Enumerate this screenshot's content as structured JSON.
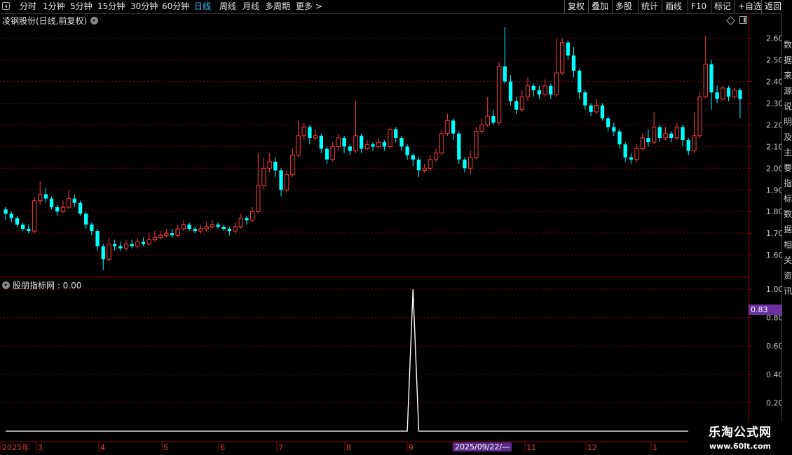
{
  "toolbar": {
    "periods": [
      "分时",
      "1分钟",
      "5分钟",
      "15分钟",
      "30分钟",
      "60分钟",
      "日线",
      "周线",
      "月线",
      "多周期",
      "更多 >"
    ],
    "active_period": "日线",
    "right_buttons": [
      "复权",
      "叠加",
      "多股",
      "统计",
      "画线",
      "F10",
      "标记",
      "+自选",
      "返回"
    ]
  },
  "main_title": "凌钢股份(日线,前复权)",
  "indicator_label": "股朋指标网 : 0.00",
  "value_tag": "0.83",
  "date_tag": "2025/09/22/—",
  "watermark": {
    "line1": "乐淘公式网",
    "line2": "www.60lt.com"
  },
  "right_strip_chars": [
    "数",
    "据",
    "来",
    "源",
    "说",
    "明",
    "及",
    "主",
    "要",
    "指",
    "标",
    "数",
    "据",
    "相",
    "关",
    "资",
    "讯"
  ],
  "x_axis_labels": [
    "2025年",
    "3",
    "4",
    "5",
    "6",
    "7",
    "8",
    "9",
    "10",
    "11",
    "12",
    "1"
  ],
  "colors": {
    "up": "#ff3c3c",
    "down": "#00ffff",
    "grid": "#7a0000",
    "axis": "#8b0000"
  },
  "chart_data": [
    {
      "type": "candlestick",
      "title": "凌钢股份(日线,前复权)",
      "y_ticks": [
        "2.60",
        "2.50",
        "2.40",
        "2.30",
        "2.20",
        "2.10",
        "2.00",
        "1.90",
        "1.80",
        "1.70",
        "1.60"
      ],
      "ylim": [
        1.51,
        2.66
      ],
      "candles": [
        [
          1.81,
          1.79,
          1.82,
          1.76
        ],
        [
          1.79,
          1.77,
          1.8,
          1.75
        ],
        [
          1.77,
          1.74,
          1.78,
          1.73
        ],
        [
          1.74,
          1.72,
          1.75,
          1.71
        ],
        [
          1.72,
          1.71,
          1.74,
          1.7
        ],
        [
          1.71,
          1.85,
          1.87,
          1.7
        ],
        [
          1.85,
          1.88,
          1.94,
          1.83
        ],
        [
          1.88,
          1.86,
          1.91,
          1.84
        ],
        [
          1.86,
          1.82,
          1.87,
          1.81
        ],
        [
          1.82,
          1.8,
          1.83,
          1.78
        ],
        [
          1.8,
          1.82,
          1.85,
          1.79
        ],
        [
          1.82,
          1.86,
          1.9,
          1.81
        ],
        [
          1.86,
          1.84,
          1.88,
          1.82
        ],
        [
          1.84,
          1.79,
          1.85,
          1.78
        ],
        [
          1.79,
          1.74,
          1.8,
          1.72
        ],
        [
          1.74,
          1.71,
          1.75,
          1.69
        ],
        [
          1.71,
          1.64,
          1.72,
          1.62
        ],
        [
          1.64,
          1.58,
          1.65,
          1.53
        ],
        [
          1.58,
          1.65,
          1.68,
          1.57
        ],
        [
          1.65,
          1.64,
          1.67,
          1.62
        ],
        [
          1.64,
          1.63,
          1.66,
          1.62
        ],
        [
          1.63,
          1.65,
          1.67,
          1.62
        ],
        [
          1.65,
          1.64,
          1.67,
          1.63
        ],
        [
          1.64,
          1.66,
          1.68,
          1.63
        ],
        [
          1.66,
          1.65,
          1.68,
          1.64
        ],
        [
          1.65,
          1.67,
          1.7,
          1.64
        ],
        [
          1.67,
          1.68,
          1.71,
          1.66
        ],
        [
          1.68,
          1.69,
          1.71,
          1.67
        ],
        [
          1.69,
          1.7,
          1.72,
          1.68
        ],
        [
          1.7,
          1.69,
          1.72,
          1.68
        ],
        [
          1.69,
          1.72,
          1.74,
          1.68
        ],
        [
          1.72,
          1.74,
          1.76,
          1.71
        ],
        [
          1.74,
          1.72,
          1.75,
          1.71
        ],
        [
          1.72,
          1.71,
          1.73,
          1.7
        ],
        [
          1.71,
          1.72,
          1.74,
          1.7
        ],
        [
          1.72,
          1.73,
          1.75,
          1.71
        ],
        [
          1.73,
          1.74,
          1.76,
          1.72
        ],
        [
          1.74,
          1.73,
          1.75,
          1.72
        ],
        [
          1.73,
          1.72,
          1.74,
          1.71
        ],
        [
          1.72,
          1.71,
          1.73,
          1.69
        ],
        [
          1.71,
          1.73,
          1.75,
          1.7
        ],
        [
          1.73,
          1.77,
          1.79,
          1.72
        ],
        [
          1.77,
          1.76,
          1.78,
          1.74
        ],
        [
          1.76,
          1.8,
          1.82,
          1.75
        ],
        [
          1.8,
          1.92,
          2.07,
          1.79
        ],
        [
          1.92,
          2.0,
          2.05,
          1.9
        ],
        [
          2.0,
          2.03,
          2.07,
          1.98
        ],
        [
          2.03,
          1.99,
          2.05,
          1.96
        ],
        [
          1.99,
          1.9,
          2.0,
          1.87
        ],
        [
          1.9,
          1.97,
          1.99,
          1.89
        ],
        [
          1.97,
          2.06,
          2.09,
          1.96
        ],
        [
          2.06,
          2.15,
          2.22,
          2.05
        ],
        [
          2.15,
          2.19,
          2.21,
          2.13
        ],
        [
          2.19,
          2.14,
          2.2,
          2.11
        ],
        [
          2.14,
          2.15,
          2.18,
          2.13
        ],
        [
          2.15,
          2.09,
          2.16,
          2.07
        ],
        [
          2.09,
          2.04,
          2.1,
          2.02
        ],
        [
          2.04,
          2.1,
          2.12,
          2.03
        ],
        [
          2.1,
          2.14,
          2.16,
          2.08
        ],
        [
          2.14,
          2.1,
          2.15,
          2.07
        ],
        [
          2.1,
          2.08,
          2.11,
          2.06
        ],
        [
          2.08,
          2.15,
          2.31,
          2.07
        ],
        [
          2.15,
          2.09,
          2.16,
          2.07
        ],
        [
          2.09,
          2.11,
          2.13,
          2.08
        ],
        [
          2.11,
          2.1,
          2.12,
          2.08
        ],
        [
          2.1,
          2.12,
          2.14,
          2.09
        ],
        [
          2.12,
          2.1,
          2.13,
          2.08
        ],
        [
          2.1,
          2.18,
          2.19,
          2.09
        ],
        [
          2.18,
          2.14,
          2.19,
          2.12
        ],
        [
          2.14,
          2.1,
          2.15,
          2.08
        ],
        [
          2.1,
          2.06,
          2.11,
          2.04
        ],
        [
          2.06,
          2.04,
          2.07,
          2.01
        ],
        [
          2.04,
          1.99,
          2.05,
          1.96
        ],
        [
          1.99,
          2.0,
          2.02,
          1.98
        ],
        [
          2.0,
          2.04,
          2.06,
          1.99
        ],
        [
          2.04,
          2.07,
          2.09,
          2.03
        ],
        [
          2.07,
          2.16,
          2.18,
          2.06
        ],
        [
          2.16,
          2.22,
          2.25,
          2.15
        ],
        [
          2.22,
          2.16,
          2.23,
          2.13
        ],
        [
          2.16,
          2.04,
          2.17,
          2.02
        ],
        [
          2.04,
          2.0,
          2.05,
          1.98
        ],
        [
          2.0,
          2.05,
          2.08,
          1.97
        ],
        [
          2.05,
          2.17,
          2.19,
          2.04
        ],
        [
          2.17,
          2.2,
          2.23,
          2.16
        ],
        [
          2.2,
          2.24,
          2.33,
          2.19
        ],
        [
          2.24,
          2.21,
          2.27,
          2.2
        ],
        [
          2.21,
          2.47,
          2.49,
          2.2
        ],
        [
          2.47,
          2.4,
          2.65,
          2.39
        ],
        [
          2.4,
          2.31,
          2.43,
          2.29
        ],
        [
          2.31,
          2.27,
          2.33,
          2.25
        ],
        [
          2.27,
          2.33,
          2.36,
          2.26
        ],
        [
          2.33,
          2.38,
          2.42,
          2.31
        ],
        [
          2.38,
          2.36,
          2.39,
          2.33
        ],
        [
          2.36,
          2.34,
          2.38,
          2.32
        ],
        [
          2.34,
          2.38,
          2.41,
          2.33
        ],
        [
          2.38,
          2.34,
          2.39,
          2.32
        ],
        [
          2.34,
          2.44,
          2.6,
          2.33
        ],
        [
          2.44,
          2.58,
          2.6,
          2.43
        ],
        [
          2.58,
          2.52,
          2.59,
          2.5
        ],
        [
          2.52,
          2.45,
          2.56,
          2.42
        ],
        [
          2.45,
          2.35,
          2.46,
          2.32
        ],
        [
          2.35,
          2.29,
          2.36,
          2.27
        ],
        [
          2.29,
          2.26,
          2.3,
          2.24
        ],
        [
          2.26,
          2.29,
          2.32,
          2.25
        ],
        [
          2.29,
          2.23,
          2.3,
          2.22
        ],
        [
          2.23,
          2.19,
          2.24,
          2.17
        ],
        [
          2.19,
          2.17,
          2.21,
          2.15
        ],
        [
          2.17,
          2.11,
          2.18,
          2.09
        ],
        [
          2.11,
          2.05,
          2.12,
          2.03
        ],
        [
          2.05,
          2.04,
          2.07,
          2.02
        ],
        [
          2.04,
          2.09,
          2.11,
          2.03
        ],
        [
          2.09,
          2.14,
          2.16,
          2.08
        ],
        [
          2.14,
          2.12,
          2.18,
          2.1
        ],
        [
          2.12,
          2.19,
          2.26,
          2.11
        ],
        [
          2.19,
          2.14,
          2.2,
          2.12
        ],
        [
          2.14,
          2.16,
          2.19,
          2.13
        ],
        [
          2.16,
          2.14,
          2.17,
          2.12
        ],
        [
          2.14,
          2.19,
          2.21,
          2.13
        ],
        [
          2.19,
          2.13,
          2.2,
          2.1
        ],
        [
          2.13,
          2.08,
          2.14,
          2.06
        ],
        [
          2.08,
          2.15,
          2.26,
          2.07
        ],
        [
          2.15,
          2.33,
          2.35,
          2.14
        ],
        [
          2.33,
          2.48,
          2.61,
          2.32
        ],
        [
          2.48,
          2.35,
          2.5,
          2.27
        ],
        [
          2.35,
          2.32,
          2.38,
          2.3
        ],
        [
          2.32,
          2.37,
          2.38,
          2.31
        ],
        [
          2.37,
          2.33,
          2.38,
          2.31
        ],
        [
          2.33,
          2.36,
          2.37,
          2.32
        ],
        [
          2.36,
          2.32,
          2.37,
          2.23
        ]
      ]
    },
    {
      "type": "line",
      "title": "股朋指标网",
      "y_ticks": [
        "1.00",
        "0.80",
        "0.60",
        "0.40",
        "0.20"
      ],
      "ylim": [
        -0.05,
        1.05
      ],
      "series": [
        {
          "values": [
            0,
            0,
            0,
            0,
            0,
            0,
            0,
            0,
            0,
            0,
            0,
            0,
            0,
            0,
            0,
            0,
            0,
            0,
            0,
            0,
            0,
            0,
            0,
            0,
            0,
            0,
            0,
            0,
            0,
            0,
            0,
            0,
            0,
            0,
            0,
            0,
            0,
            0,
            0,
            0,
            0,
            0,
            0,
            0,
            0,
            0,
            0,
            0,
            0,
            0,
            0,
            0,
            0,
            0,
            0,
            0,
            0,
            0,
            0,
            0,
            0,
            0,
            0,
            0,
            0,
            0,
            0,
            0,
            0,
            0,
            0,
            1,
            0,
            0,
            0,
            0,
            0,
            0,
            0,
            0,
            0,
            0,
            0,
            0,
            0,
            0,
            0,
            0,
            0,
            0,
            0,
            0,
            0,
            0,
            0,
            0,
            0,
            0,
            0,
            0,
            0,
            0,
            0,
            0,
            0,
            0,
            0,
            0,
            0,
            0,
            0,
            0,
            0,
            0,
            0,
            0,
            0,
            0,
            0,
            0,
            0,
            0,
            0,
            0,
            0,
            0,
            0,
            0,
            0,
            0,
            0,
            0,
            0,
            0
          ]
        }
      ]
    }
  ]
}
